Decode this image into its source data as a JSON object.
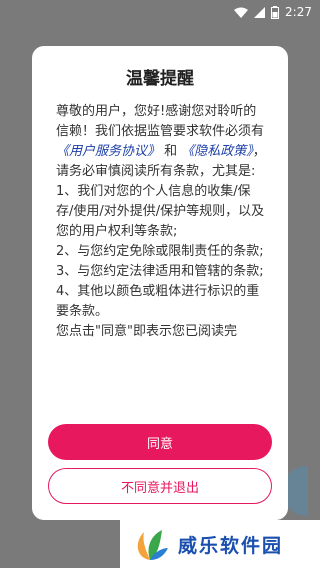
{
  "status_bar": {
    "time": "2:27",
    "icons": [
      "wifi-icon",
      "signal-icon",
      "battery-icon"
    ]
  },
  "dialog": {
    "title": "温馨提醒",
    "body": {
      "intro": "尊敬的用户，您好!感谢您对聆听的信赖！我们依据监管要求软件必须有",
      "link_service": "《用户服务协议》",
      "and": " 和 ",
      "link_privacy": "《隐私政策》",
      "after_links": "，请务必审慎阅读所有条款，尤其是:",
      "item1": "1、我们对您的个人信息的收集/保存/使用/对外提供/保护等规则，以及您的用户权利等条款;",
      "item2": "2、与您约定免除或限制责任的条款;",
      "item3": "3、与您约定法律适用和管辖的条款;",
      "item4": "4、其他以颜色或粗体进行标识的重要条款。",
      "cutoff": "您点击\"同意\"即表示您已阅读完"
    },
    "agree_label": "同意",
    "disagree_label": "不同意并退出"
  },
  "watermark": {
    "text": "威乐软件园"
  },
  "colors": {
    "accent": "#e8185e",
    "link": "#1c3fa8",
    "overlay": "#7a7a7a"
  }
}
